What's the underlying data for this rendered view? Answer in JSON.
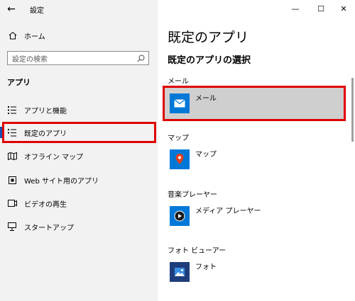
{
  "sidebar": {
    "app_title": "設定",
    "home_label": "ホーム",
    "search_placeholder": "設定の検索",
    "section_title": "アプリ",
    "items": [
      {
        "label": "アプリと機能",
        "icon": "list-icon"
      },
      {
        "label": "既定のアプリ",
        "icon": "default-apps-icon",
        "selected": true
      },
      {
        "label": "オフライン マップ",
        "icon": "map-icon"
      },
      {
        "label": "Web サイト用のアプリ",
        "icon": "web-apps-icon"
      },
      {
        "label": "ビデオの再生",
        "icon": "video-icon"
      },
      {
        "label": "スタートアップ",
        "icon": "startup-icon"
      }
    ]
  },
  "main": {
    "title": "既定のアプリ",
    "subtitle": "既定のアプリの選択",
    "categories": [
      {
        "category": "メール",
        "app": "メール",
        "icon": "mail-icon",
        "color": "#0078d7"
      },
      {
        "category": "マップ",
        "app": "マップ",
        "icon": "map-pin-icon",
        "color": "#0078d7"
      },
      {
        "category": "音楽プレーヤー",
        "app": "メディア プレーヤー",
        "icon": "media-player-icon",
        "color": "#0078d7"
      },
      {
        "category": "フォト ビューアー",
        "app": "フォト",
        "icon": "photos-icon",
        "color": "#1e3d7b"
      }
    ]
  },
  "window_controls": {
    "minimize": "—",
    "maximize": "☐",
    "close": "✕"
  },
  "colors": {
    "accent": "#0078d7",
    "highlight_border": "#e00000",
    "selected_row": "#cfcfcf"
  }
}
